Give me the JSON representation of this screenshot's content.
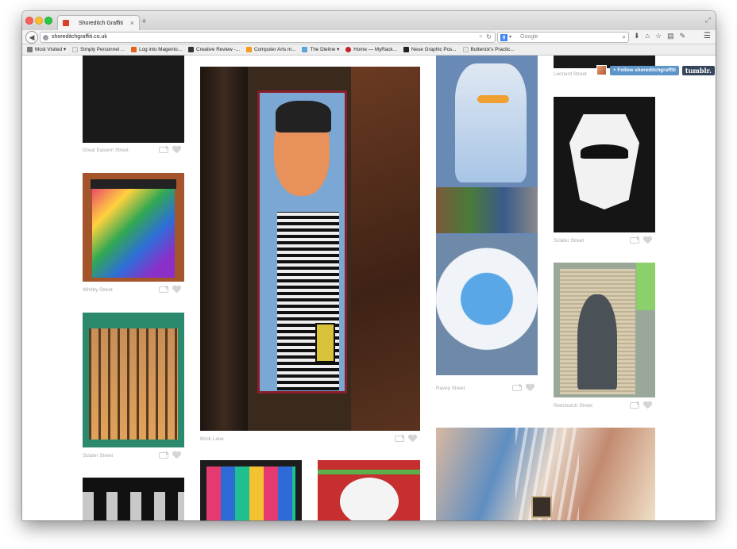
{
  "browser": {
    "tab_title": "Shoreditch Graffiti",
    "new_tab": "+",
    "url": "shoreditchgraffiti.co.uk",
    "search_placeholder": "Google",
    "search_engine_letter": "g",
    "search_engine_dropdown": "▾"
  },
  "bookmarks": [
    {
      "label": "Most Visited ▾",
      "color": "#7a7a7a"
    },
    {
      "label": "Simply Personnel ...",
      "color": "#e8e8e8"
    },
    {
      "label": "Log into Magento...",
      "color": "#e2661a"
    },
    {
      "label": "Creative Review -...",
      "color": "#333333"
    },
    {
      "label": "Computer Arts m...",
      "color": "#f39a1f"
    },
    {
      "label": "The Dieline ▾",
      "color": "#5aa6d6"
    },
    {
      "label": "Home — MyRack...",
      "color": "#c8202b"
    },
    {
      "label": "Neue Graphic Pos...",
      "color": "#222222"
    },
    {
      "label": "Butterick's Practic...",
      "color": "#e8e8e8"
    }
  ],
  "header": {
    "follow_label": "+ Follow shoreditchgraffiti",
    "tumblr_label": "tumblr."
  },
  "posts": [
    {
      "caption": "Great Eastern Street"
    },
    {
      "caption": "Whitby Street"
    },
    {
      "caption": "Sclater Street"
    },
    {
      "caption": "Brick Lane"
    },
    {
      "caption": "Ravey Street"
    },
    {
      "caption": "Leonard Street"
    },
    {
      "caption": "Sclater Street"
    },
    {
      "caption": "Redchurch Street"
    }
  ]
}
